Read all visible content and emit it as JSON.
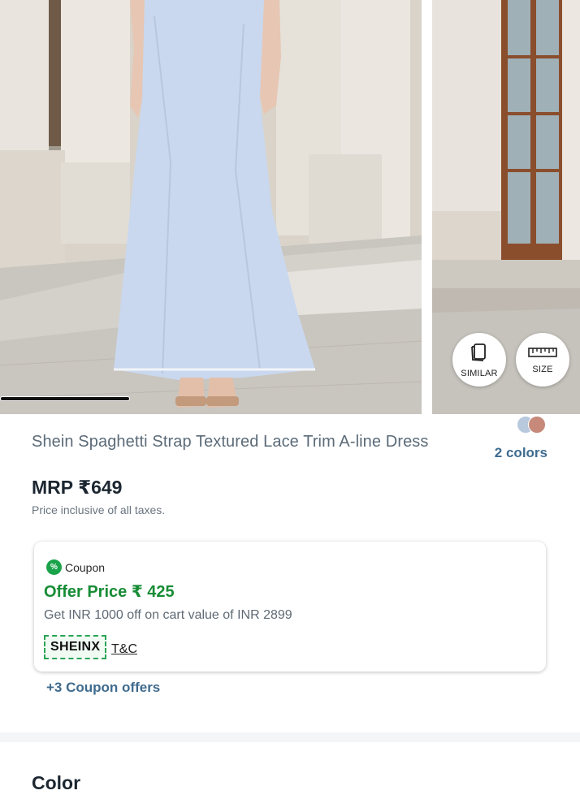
{
  "gallery": {
    "carousel_progress": 0.31,
    "similar_label": "SIMILAR",
    "size_label": "SIZE",
    "icons": [
      "cards-icon",
      "ruler-icon"
    ]
  },
  "product": {
    "title": "Shein Spaghetti Strap Textured Lace Trim A-line Dress",
    "colors_count": "2 colors",
    "swatch_colors": [
      "#b9c9dd",
      "#c6897a"
    ],
    "mrp": "MRP ₹649",
    "tax_note": "Price inclusive of all taxes."
  },
  "coupon": {
    "badge": "%",
    "label": "Coupon",
    "offer_price": "Offer Price ₹ 425",
    "description": "Get INR 1000 off on cart value of INR 2899",
    "code": "SHEINX",
    "tnc": "T&C",
    "more_offers": "+3 Coupon offers"
  },
  "sections": {
    "color_heading": "Color"
  },
  "colors": {
    "accent_blue": "#3f6b8e",
    "offer_green": "#178c35",
    "dress_blue": "#c9d8ee"
  }
}
